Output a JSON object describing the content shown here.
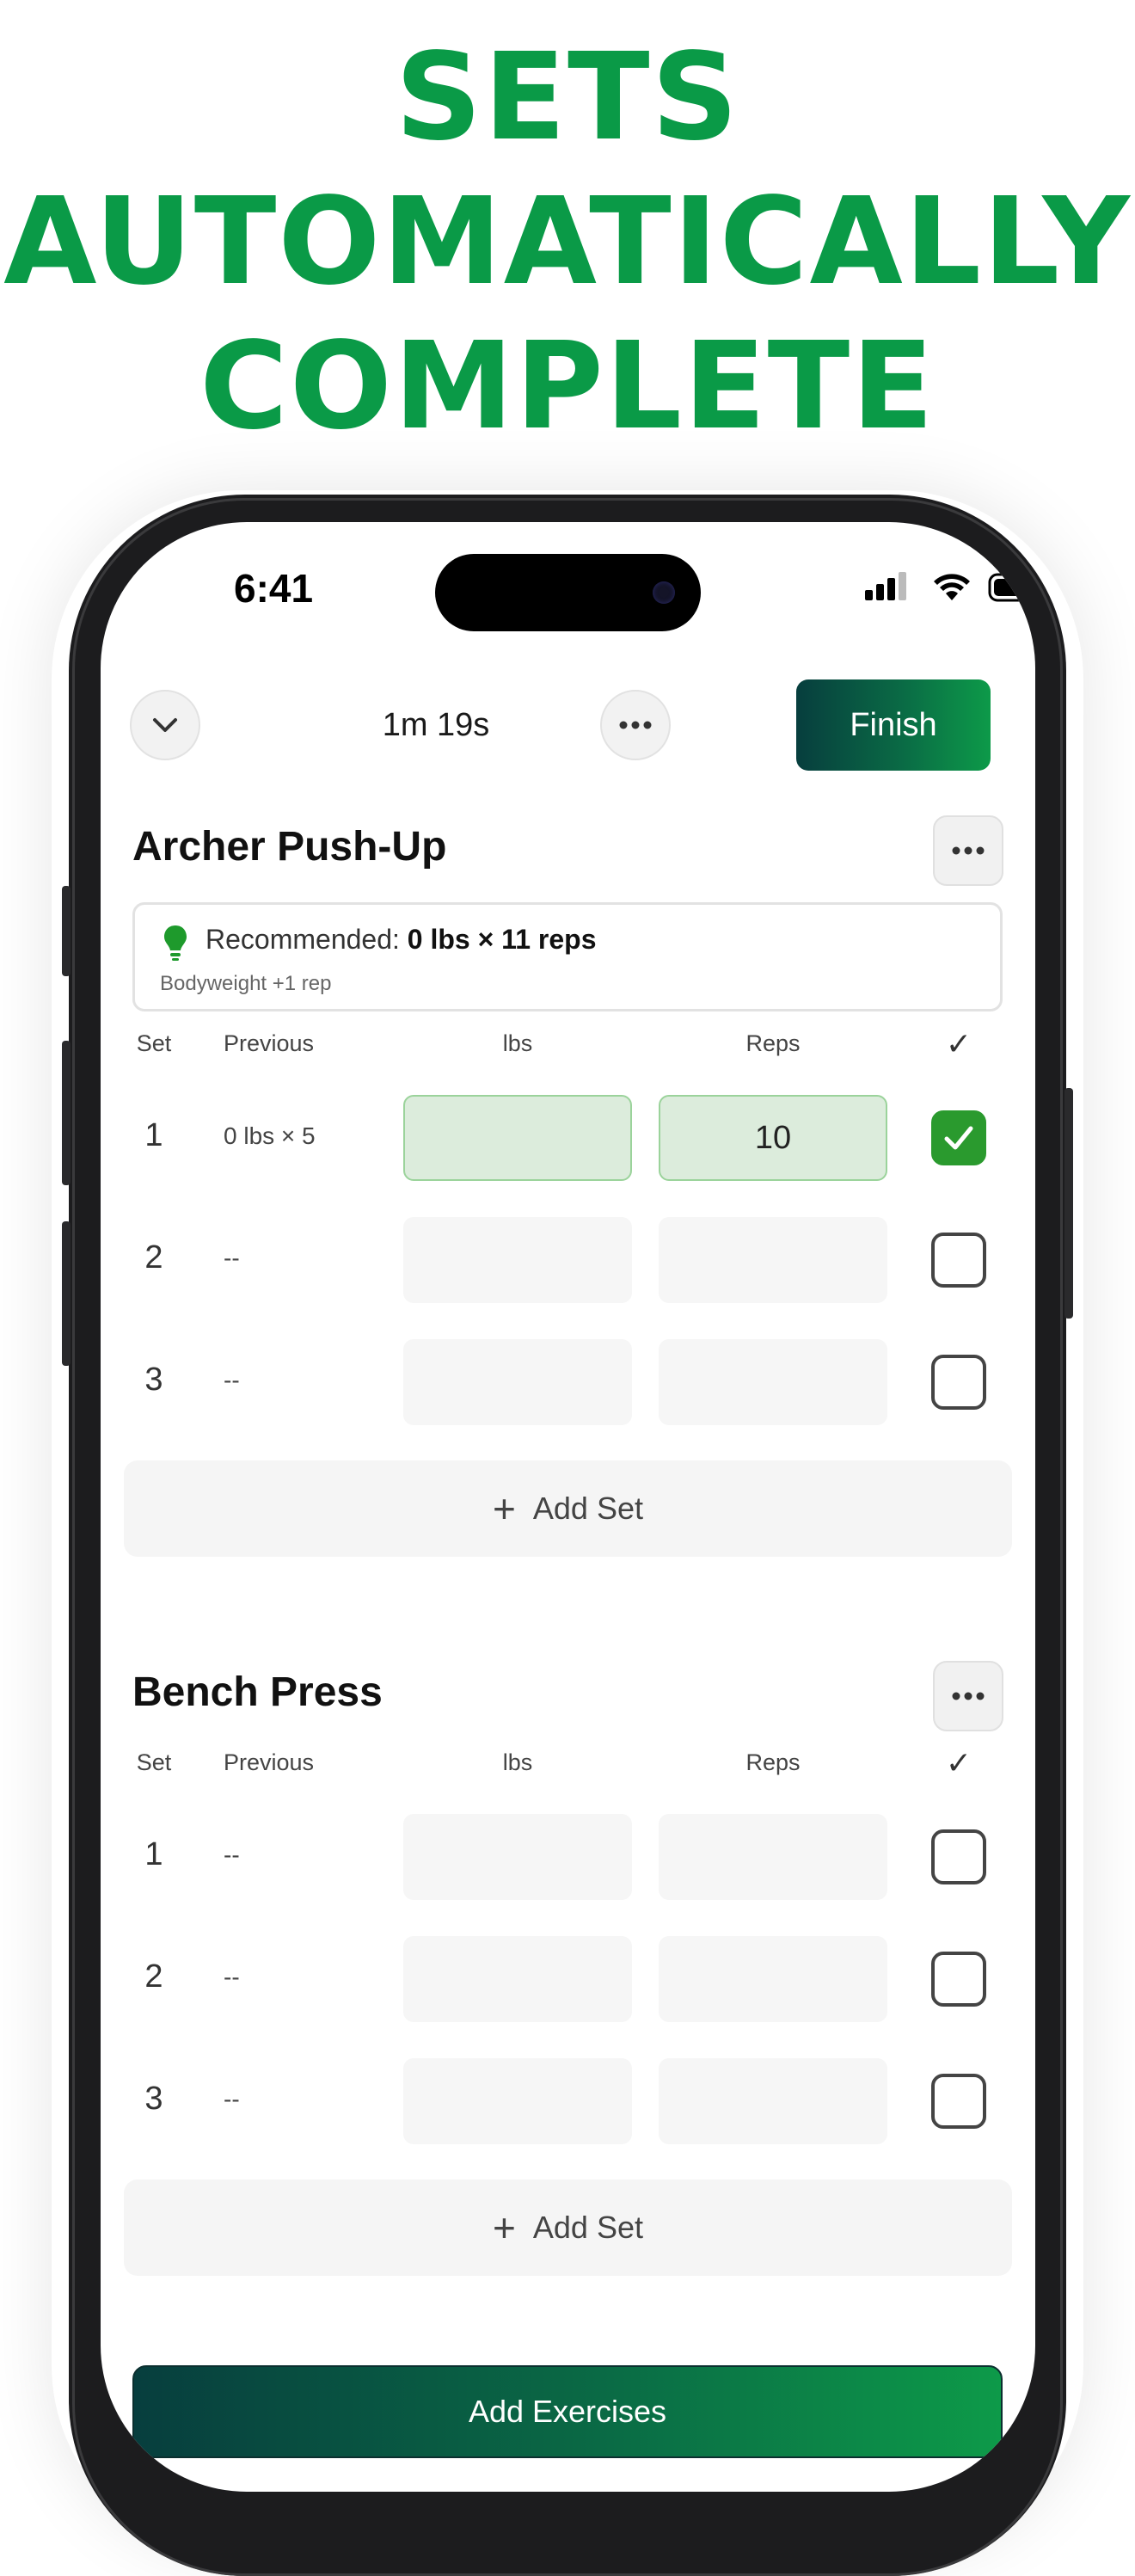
{
  "headline": {
    "line1": "SETS",
    "line2": "AUTOMATICALLY",
    "line3": "COMPLETE"
  },
  "status_bar": {
    "time": "6:41"
  },
  "toolbar": {
    "timer": "1m 19s",
    "finish_label": "Finish"
  },
  "colors": {
    "brand_green": "#0a9a47",
    "gradient_start": "#073e3e",
    "gradient_end": "#0d9a49",
    "check_green": "#2a9a2e"
  },
  "table_headers": {
    "set": "Set",
    "previous": "Previous",
    "lbs": "lbs",
    "reps": "Reps",
    "done": "✓"
  },
  "exercises": [
    {
      "name": "Archer Push-Up",
      "recommendation": {
        "label": "Recommended:",
        "value": "0 lbs × 11 reps",
        "note": "Bodyweight +1 rep"
      },
      "sets": [
        {
          "set": "1",
          "previous": "0 lbs × 5",
          "lbs": "",
          "reps": "10",
          "completed": true
        },
        {
          "set": "2",
          "previous": "--",
          "lbs": "",
          "reps": "",
          "completed": false
        },
        {
          "set": "3",
          "previous": "--",
          "lbs": "",
          "reps": "",
          "completed": false
        }
      ],
      "add_set_label": "Add Set"
    },
    {
      "name": "Bench Press",
      "sets": [
        {
          "set": "1",
          "previous": "--",
          "lbs": "",
          "reps": "",
          "completed": false
        },
        {
          "set": "2",
          "previous": "--",
          "lbs": "",
          "reps": "",
          "completed": false
        },
        {
          "set": "3",
          "previous": "--",
          "lbs": "",
          "reps": "",
          "completed": false
        }
      ],
      "add_set_label": "Add Set"
    }
  ],
  "add_exercises_label": "Add Exercises",
  "icons": {
    "collapse": "chevron-down-icon",
    "menu": "more-horizontal-icon",
    "tip": "lightbulb-icon",
    "add": "plus-icon",
    "check": "checkmark-icon"
  }
}
